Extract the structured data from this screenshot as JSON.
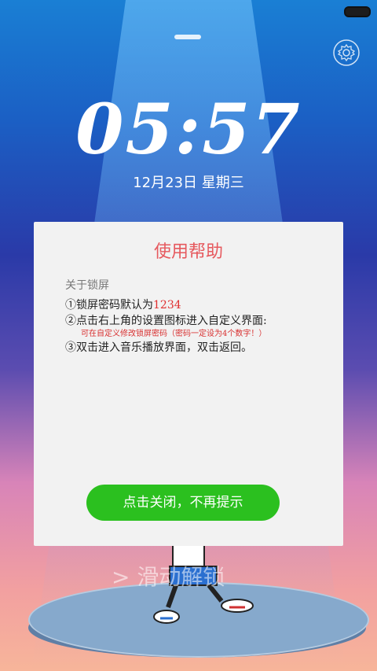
{
  "lockscreen": {
    "time": "05:57",
    "date": "12月23日  星期三",
    "unlock_hint": "滑动解锁",
    "chevron": ">"
  },
  "icons": {
    "battery": "battery-icon",
    "gear": "gear-icon",
    "chevron": "chevron-right-icon"
  },
  "dialog": {
    "title": "使用帮助",
    "section_label": "关于锁屏",
    "item1_prefix": "①锁屏密码默认为",
    "item1_value": "1234",
    "item2": "②点击右上角的设置图标进入自定义界面:",
    "item2_note": "可在自定义修改锁屏密码（密码一定设为4个数字！）",
    "item3": "③双击进入音乐播放界面，双击返回。",
    "close_button": "点击关闭，不再提示"
  },
  "colors": {
    "accent_green": "#2bc01f",
    "title_red": "#e6595e",
    "highlight_red": "#e03030"
  }
}
